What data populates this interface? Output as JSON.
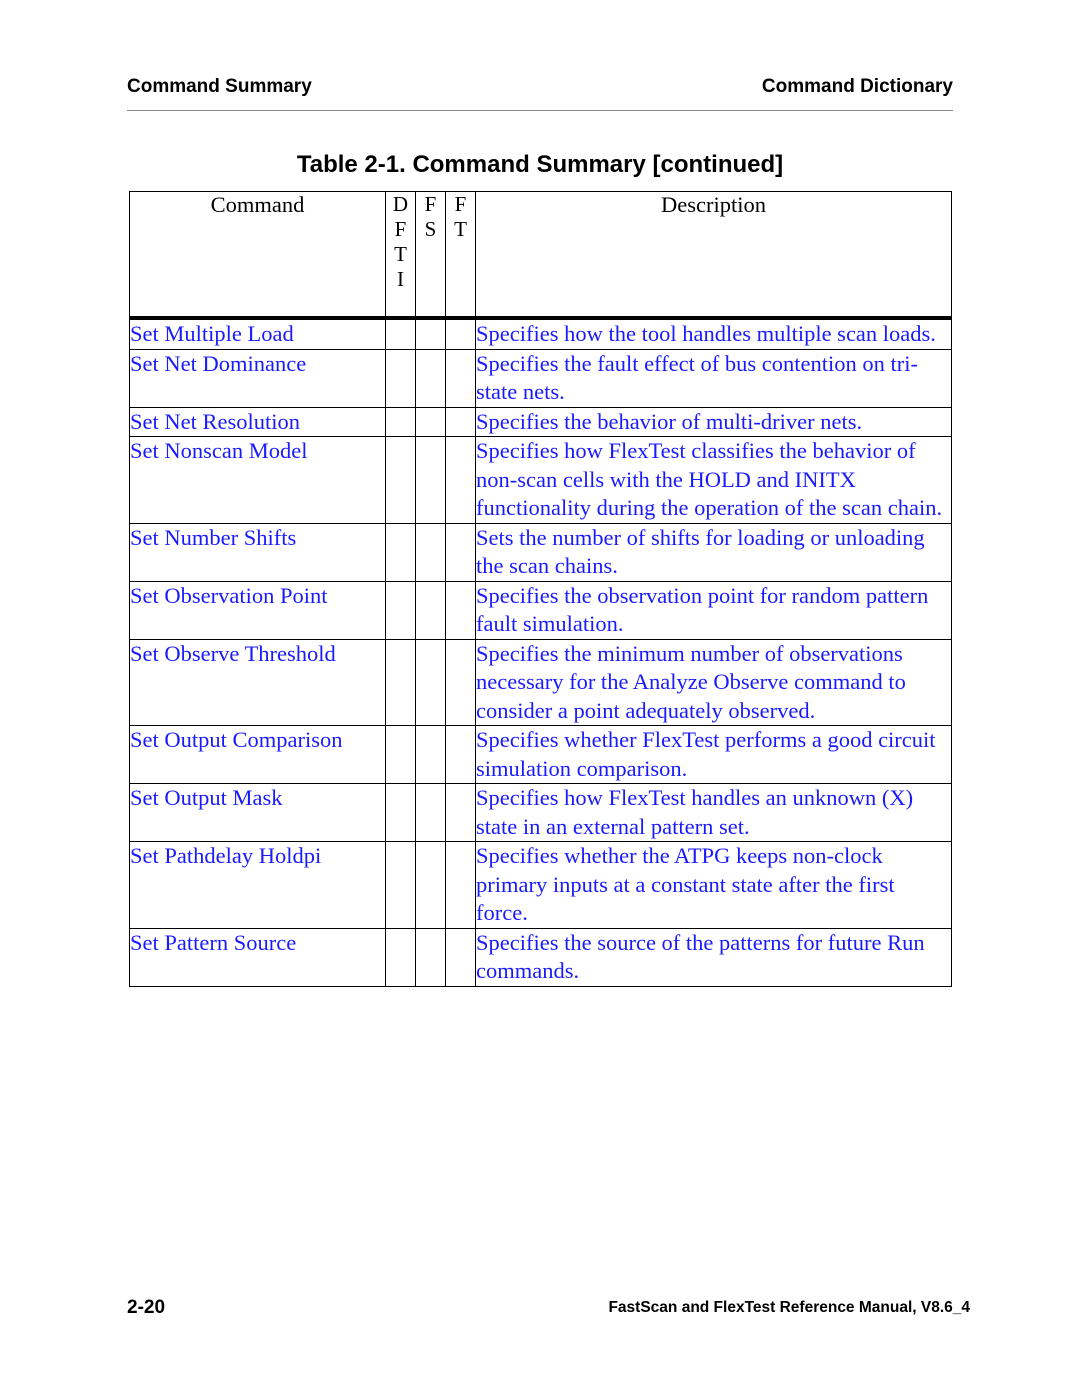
{
  "header": {
    "left": "Command Summary",
    "right": "Command Dictionary"
  },
  "table": {
    "title": "Table 2-1. Command Summary [continued]",
    "columns": {
      "command": "Command",
      "dfti": [
        "D",
        "F",
        "T",
        "I"
      ],
      "fs": [
        "F",
        "S"
      ],
      "ft": [
        "F",
        "T"
      ],
      "description": "Description"
    },
    "rows": [
      {
        "command": "Set Multiple Load",
        "dfti": "",
        "fs": "",
        "ft": "",
        "description": "Specifies how the tool handles multiple scan loads."
      },
      {
        "command": "Set Net Dominance",
        "dfti": "",
        "fs": "",
        "ft": "",
        "description": "Specifies the fault effect of bus contention on tri-state nets."
      },
      {
        "command": "Set Net Resolution",
        "dfti": "",
        "fs": "",
        "ft": "",
        "description": "Specifies the behavior of multi-driver nets."
      },
      {
        "command": "Set Nonscan Model",
        "dfti": "",
        "fs": "",
        "ft": "",
        "description": "Specifies how FlexTest classifies the behavior of non-scan cells with the HOLD and INITX functionality during the operation of the scan chain."
      },
      {
        "command": "Set Number Shifts",
        "dfti": "",
        "fs": "",
        "ft": "",
        "description": "Sets the number of shifts for loading or unloading the scan chains."
      },
      {
        "command": "Set Observation Point",
        "dfti": "",
        "fs": "",
        "ft": "",
        "description": "Specifies the observation point for random pattern fault simulation."
      },
      {
        "command": "Set Observe Threshold",
        "dfti": "",
        "fs": "",
        "ft": "",
        "description": "Specifies the minimum number of observations necessary for the Analyze Observe command to consider a point adequately observed."
      },
      {
        "command": "Set Output Comparison",
        "dfti": "",
        "fs": "",
        "ft": "",
        "description": "Specifies whether FlexTest performs a good circuit simulation comparison."
      },
      {
        "command": "Set Output Mask",
        "dfti": "",
        "fs": "",
        "ft": "",
        "description": "Specifies how FlexTest handles an unknown (X) state in an external pattern set."
      },
      {
        "command": "Set Pathdelay Holdpi",
        "dfti": "",
        "fs": "",
        "ft": "",
        "description": "Specifies whether the ATPG keeps non-clock primary inputs at a constant state after the first force."
      },
      {
        "command": "Set Pattern Source",
        "dfti": "",
        "fs": "",
        "ft": "",
        "description": "Specifies the source of the patterns for future Run commands."
      }
    ]
  },
  "footer": {
    "page_number": "2-20",
    "book_title": "FastScan and FlexTest Reference Manual, V8.6_4"
  },
  "colors": {
    "link": "#1a1aff",
    "text": "#000000",
    "rule": "#888888"
  }
}
